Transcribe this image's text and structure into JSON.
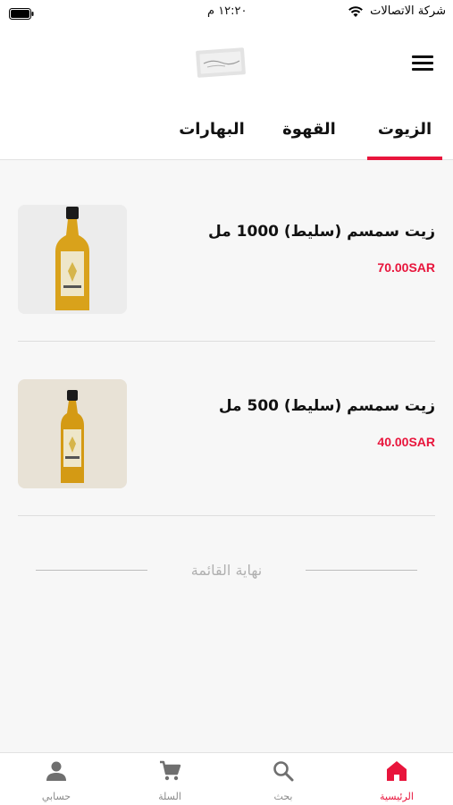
{
  "status_bar": {
    "carrier": "شركة الاتصالات",
    "time": "١٢:٢٠ م"
  },
  "header": {
    "tabs": [
      {
        "label": "الزيوت",
        "active": true
      },
      {
        "label": "القهوة",
        "active": false
      },
      {
        "label": "البهارات",
        "active": false
      }
    ]
  },
  "products": [
    {
      "name": "زيت سمسم (سليط) 1000 مل",
      "price": "70.00SAR"
    },
    {
      "name": "زيت سمسم (سليط) 500 مل",
      "price": "40.00SAR"
    }
  ],
  "end_of_list": "نهاية القائمة",
  "bottom_nav": [
    {
      "label": "الرئيسية",
      "icon": "home-icon",
      "active": true
    },
    {
      "label": "بحث",
      "icon": "search-icon",
      "active": false
    },
    {
      "label": "السلة",
      "icon": "cart-icon",
      "active": false
    },
    {
      "label": "حسابي",
      "icon": "user-icon",
      "active": false
    }
  ],
  "colors": {
    "accent": "#e8153c",
    "background": "#f7f7f7",
    "header": "#ffffff"
  }
}
